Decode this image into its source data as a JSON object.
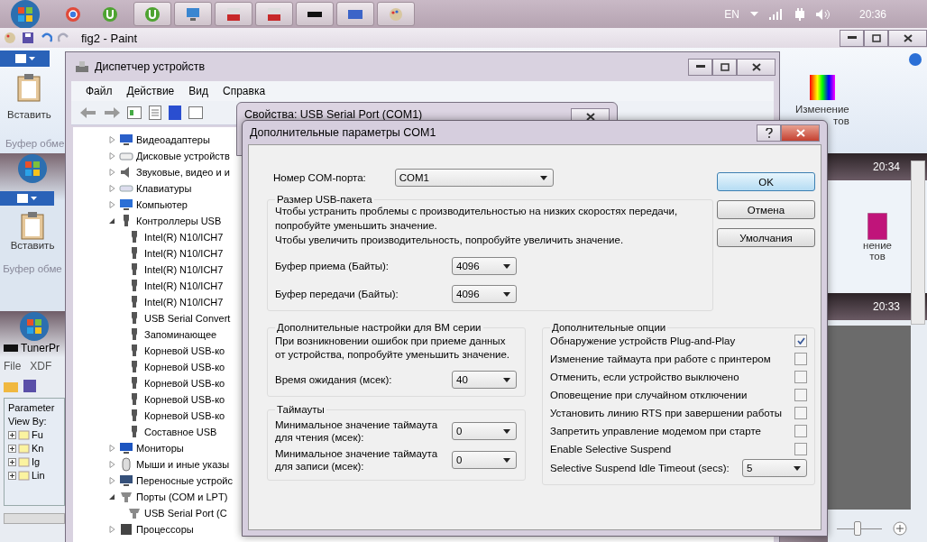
{
  "taskbar": {
    "language": "EN",
    "time": "20:36"
  },
  "paint_window": {
    "title": "fig2 - Paint",
    "paste_label": "Вставить",
    "group_label": "Буфер обме",
    "colors_label": "Изменение",
    "colors_label_tail": "тов"
  },
  "nested_left": {
    "paste_label": "Вставить",
    "group_label": "Буфер обме",
    "app_title": "TunerPr",
    "menu": [
      "File",
      "XDF"
    ],
    "panel_title": "Parameter",
    "view_by": "View By:",
    "tree": [
      "Fu",
      "Kn",
      "Ig",
      "Lin"
    ]
  },
  "nested_right": {
    "times": [
      "20:34",
      "20:33"
    ],
    "label_lines": [
      "нение",
      "тов"
    ],
    "zoom": {
      "level": 0.45
    }
  },
  "device_manager": {
    "title": "Диспетчер устройств",
    "menu": [
      "Файл",
      "Действие",
      "Вид",
      "Справка"
    ],
    "tree": [
      {
        "label": "Видеоадаптеры",
        "kind": "display",
        "expanded": false
      },
      {
        "label": "Дисковые устройств",
        "kind": "disk",
        "expanded": false
      },
      {
        "label": "Звуковые, видео и и",
        "kind": "speaker",
        "expanded": false
      },
      {
        "label": "Клавиатуры",
        "kind": "keyboard",
        "expanded": false
      },
      {
        "label": "Компьютер",
        "kind": "computer",
        "expanded": false
      },
      {
        "label": "Контроллеры USB",
        "kind": "usb",
        "expanded": true,
        "children": [
          {
            "label": "Intel(R) N10/ICH7",
            "kind": "usb"
          },
          {
            "label": "Intel(R) N10/ICH7",
            "kind": "usb"
          },
          {
            "label": "Intel(R) N10/ICH7",
            "kind": "usb"
          },
          {
            "label": "Intel(R) N10/ICH7",
            "kind": "usb"
          },
          {
            "label": "Intel(R) N10/ICH7",
            "kind": "usb"
          },
          {
            "label": "USB Serial Convert",
            "kind": "usb"
          },
          {
            "label": "Запоминающее",
            "kind": "usb"
          },
          {
            "label": "Корневой USB-ко",
            "kind": "usb"
          },
          {
            "label": "Корневой USB-ко",
            "kind": "usb"
          },
          {
            "label": "Корневой USB-ко",
            "kind": "usb"
          },
          {
            "label": "Корневой USB-ко",
            "kind": "usb"
          },
          {
            "label": "Корневой USB-ко",
            "kind": "usb"
          },
          {
            "label": "Составное USB",
            "kind": "usb"
          }
        ]
      },
      {
        "label": "Мониторы",
        "kind": "monitor",
        "expanded": false
      },
      {
        "label": "Мыши и иные указы",
        "kind": "mouse",
        "expanded": false
      },
      {
        "label": "Переносные устройс",
        "kind": "portable",
        "expanded": false
      },
      {
        "label": "Порты (COM и LPT)",
        "kind": "port",
        "expanded": true,
        "children": [
          {
            "label": "USB Serial Port (C",
            "kind": "port"
          }
        ]
      },
      {
        "label": "Процессоры",
        "kind": "cpu",
        "expanded": false
      }
    ]
  },
  "properties_window": {
    "title": "Свойства: USB Serial Port (COM1)"
  },
  "dialog": {
    "title": "Дополнительные параметры COM1",
    "com_port": {
      "label": "Номер COM-порта:",
      "value": "COM1"
    },
    "usb_group": {
      "title": "Размер USB-пакета",
      "text_lines": [
        "Чтобы устранить проблемы с производительностью на низких скоростях передачи,",
        "попробуйте уменьшить значение.",
        "Чтобы увеличить производительность, попробуйте увеличить значение."
      ],
      "fields": [
        {
          "label": "Буфер приема (Байты):",
          "value": "4096"
        },
        {
          "label": "Буфер передачи (Байты):",
          "value": "4096"
        }
      ]
    },
    "bm_group": {
      "title": "Дополнительные настройки для BM серии",
      "text": "При возникновении ошибок при приеме данных от устройства, попробуйте уменьшить значение.",
      "field": {
        "label": "Время ожидания (мсек):",
        "value": "40"
      }
    },
    "timeouts_group": {
      "title": "Таймауты",
      "fields": [
        {
          "label": "Минимальное значение таймаута для чтения (мсек):",
          "value": "0"
        },
        {
          "label": "Минимальное значение таймаута для записи (мсек):",
          "value": "0"
        }
      ]
    },
    "options_group": {
      "title": "Дополнительные опции",
      "options": [
        {
          "kind": "checkbox",
          "label": "Обнаружение устройств Plug-and-Play",
          "checked": true
        },
        {
          "kind": "checkbox",
          "label": "Изменение таймаута при работе с принтером",
          "checked": false
        },
        {
          "kind": "checkbox",
          "label": "Отменить, если устройство выключено",
          "checked": false
        },
        {
          "kind": "checkbox",
          "label": "Оповещение при случайном отключении",
          "checked": false
        },
        {
          "kind": "checkbox",
          "label": "Установить линию RTS при завершении работы",
          "checked": false
        },
        {
          "kind": "checkbox",
          "label": "Запретить управление модемом при старте",
          "checked": false
        },
        {
          "kind": "checkbox",
          "label": "Enable Selective Suspend",
          "checked": false
        },
        {
          "kind": "dropdown",
          "label": "Selective Suspend Idle Timeout (secs):",
          "value": "5"
        }
      ]
    },
    "buttons": [
      "OK",
      "Отмена",
      "Умолчания"
    ]
  }
}
